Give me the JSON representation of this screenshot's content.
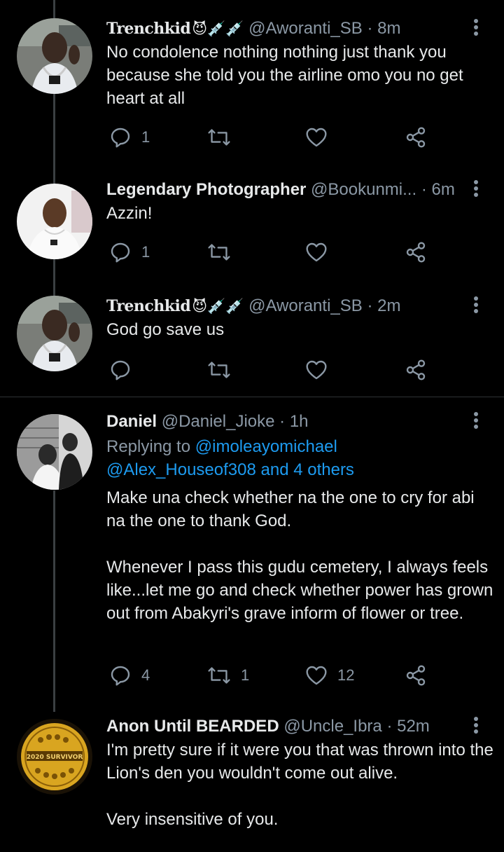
{
  "tweets": [
    {
      "name": "Trenchkid",
      "emoji": "😈💉💉",
      "handle": "@Aworanti_SB",
      "dot": "·",
      "time": "8m",
      "text": "No condolence nothing nothing just thank you because she told you the airline omo you no get heart at all",
      "reply_count": "1",
      "retweet_count": "",
      "like_count": ""
    },
    {
      "name": "Legendary Photographer",
      "handle": "@Bookunmi...",
      "dot": "·",
      "time": "6m",
      "text": "Azzin!",
      "reply_count": "1",
      "retweet_count": "",
      "like_count": ""
    },
    {
      "name": "Trenchkid",
      "emoji": "😈💉💉",
      "handle": "@Aworanti_SB",
      "dot": "·",
      "time": "2m",
      "text": "God go save us",
      "reply_count": "",
      "retweet_count": "",
      "like_count": ""
    },
    {
      "name": "Daniel",
      "handle": "@Daniel_Jioke",
      "dot": "·",
      "time": "1h",
      "replying_prefix": "Replying to ",
      "replying_mention1": "@imoleayomichael",
      "replying_mention2": "@Alex_Houseof308 and 4 others",
      "text": "Make una check whether na the one to cry for abi na the one to thank God.\n\nWhenever I pass this gudu cemetery, I always feels like...let me go and check whether power has grown out from Abakyri's grave inform of flower or tree.",
      "reply_count": "4",
      "retweet_count": "1",
      "like_count": "12"
    },
    {
      "name": "Anon Until BEARDED",
      "handle": "@Uncle_Ibra",
      "dot": "·",
      "time": "52m",
      "avatar_text": "2020 SURVIVOR",
      "text": "I'm pretty sure if it were you that was thrown into the Lion's den you wouldn't come out alive.\n\nVery insensitive of you."
    }
  ],
  "colors": {
    "background": "#000000",
    "text": "#e7e9ea",
    "muted": "#8b98a5",
    "link": "#1d9bf0",
    "divider": "#2f3336",
    "thread_line": "#3b3f42"
  },
  "icons": {
    "reply": "reply-icon",
    "retweet": "retweet-icon",
    "like": "heart-icon",
    "share": "share-icon",
    "more": "more-vertical-icon"
  }
}
